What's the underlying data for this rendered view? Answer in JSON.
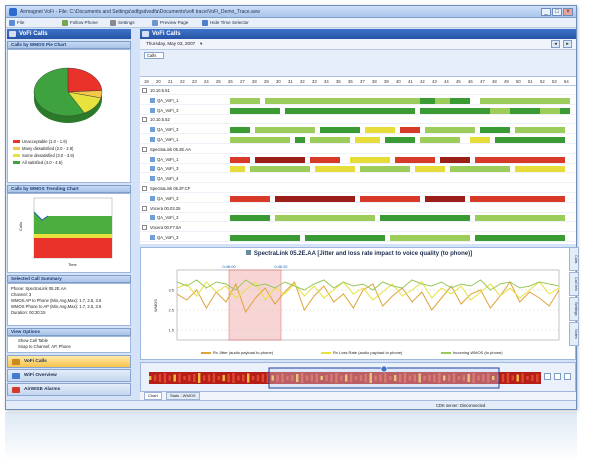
{
  "window": {
    "title": "Airmagnet VoFi - File: C:\\Documents and Settings\\sdfgsdvsdfa\\Documents\\vofi trace\\VoFi_Demo_Trace.avw",
    "minimize": "_",
    "maximize": "□",
    "close": "×"
  },
  "toolbar": {
    "file": "File",
    "follow_phone": "Follow Phone",
    "settings": "Settings",
    "preview_page": "Preview Page",
    "hide_time_selector": "Hide Time Selector"
  },
  "left_panel": {
    "header": "VoFi Calls",
    "pie_title": "Calls by WMOS Pie Chart",
    "pie_slices": [
      {
        "label": "Unacceptable (1.0 - 1.9)",
        "value": 24,
        "color": "#e8322a"
      },
      {
        "label": "Many dissatisfied (2.0 - 2.9)",
        "value": 5,
        "color": "#f4c84a"
      },
      {
        "label": "Some dissatisfied (3.0 - 3.9)",
        "value": 13,
        "color": "#e8e23f"
      },
      {
        "label": "All satisfied (4.0 - 4.5)",
        "value": 58,
        "color": "#3ea33e"
      }
    ],
    "trend_title": "Calls by WMOS Trending Chart",
    "trend_ylabel": "Calls",
    "trend_xlabel": "Time",
    "summary_title": "Selected Call Summary",
    "summary_lines": [
      "Phone: SpectraLink 05.2E.AA",
      "Channel: 3",
      "WMOS AP to Phone (Min,Avg,Max): 1.7, 2.5, 3.6",
      "WMOS Phone to AP (Min,Avg,Max): 1.7, 2.5, 3.6",
      "Duration: 00:30:15"
    ],
    "view_options_title": "View Options",
    "view_options": [
      "Show Call Table",
      "Snap to Channel: AP, Phone"
    ],
    "nav": [
      "VoFi Calls",
      "WiFi Overview",
      "AirWISE Alarms"
    ]
  },
  "right_panel": {
    "header": "VoFi Calls",
    "date": "Thursday, May 03, 2007",
    "view_label": "Calls",
    "hours": [
      "19",
      "20",
      "21",
      "22",
      "23",
      "24",
      "25",
      "26",
      "27",
      "28",
      "29",
      "30",
      "31",
      "32",
      "33",
      "34",
      "35",
      "36",
      "37",
      "38",
      "39",
      "40",
      "41",
      "42",
      "43",
      "44",
      "45",
      "46",
      "47",
      "48",
      "49",
      "50",
      "51",
      "52",
      "53",
      "54"
    ],
    "rows": [
      {
        "label": "10.10.5.51",
        "kind": "group"
      },
      {
        "label": "QA_VoFi_1",
        "kind": "call",
        "pattern": "green1"
      },
      {
        "label": "QA_VoFi_3",
        "kind": "call",
        "pattern": "green2"
      },
      {
        "label": "10.10.5.52",
        "kind": "group"
      },
      {
        "label": "QA_VoFi_3",
        "kind": "call",
        "pattern": "mixed1"
      },
      {
        "label": "QA_VoFi_1",
        "kind": "call",
        "pattern": "mixed2"
      },
      {
        "label": "SpectraLink 05.2E.AA",
        "kind": "group"
      },
      {
        "label": "QA_VoFi_1",
        "kind": "call",
        "pattern": "red1"
      },
      {
        "label": "QA_VoFi_3",
        "kind": "call",
        "pattern": "yellow1"
      },
      {
        "label": "QA_VoFi_4",
        "kind": "call",
        "pattern": "none"
      },
      {
        "label": "SpectraLink 05.2F.CF",
        "kind": "group"
      },
      {
        "label": "QA_VoFi_3",
        "kind": "call",
        "pattern": "red2"
      },
      {
        "label": "Vocera 00.03.25",
        "kind": "group"
      },
      {
        "label": "QA_VoFi_3",
        "kind": "call",
        "pattern": "green3"
      },
      {
        "label": "Vocera 00.F7.5A",
        "kind": "group"
      },
      {
        "label": "QA_VoFi_3",
        "kind": "call",
        "pattern": "green4"
      }
    ]
  },
  "chart_panel": {
    "title": "SpectraLink 05.2E.AA  [Jitter and loss rate impact to voice quality (to phone)]",
    "marker_left": "0:46:00",
    "marker_right": "0:46:32",
    "ylabel": "WMOS",
    "legend": [
      {
        "label": "Rx Jitter (audio payload to phone)",
        "color": "#e0a33a"
      },
      {
        "label": "Rx Loss Rate (audio payload to phone)",
        "color": "#e8e23f"
      },
      {
        "label": "Incoming WMOS (to phone)",
        "color": "#99c85a"
      }
    ],
    "side_tabs": [
      "Calls",
      "Call Info",
      "Settings",
      "Notes"
    ]
  },
  "chart_data": {
    "type": "line",
    "title": "SpectraLink 05.2E.AA  [Jitter and loss rate impact to voice quality (to phone)]",
    "ylabel": "WMOS",
    "ylim": [
      1,
      4.5
    ],
    "series": [
      {
        "name": "Rx Jitter (audio payload to phone)",
        "values": [
          3.3,
          3.0,
          3.5,
          2.6,
          3.4,
          2.9,
          3.8,
          2.4,
          3.1,
          3.6,
          2.8,
          3.4,
          3.9,
          2.5,
          3.2,
          3.7,
          2.9,
          3.3,
          2.6,
          3.5,
          3.8,
          2.7,
          3.2,
          3.6,
          2.9,
          3.4,
          2.5,
          3.1,
          3.7,
          2.8,
          3.3,
          3.5,
          2.6,
          3.2,
          3.9,
          2.9,
          3.4,
          3.1,
          2.7,
          3.5
        ]
      },
      {
        "name": "Rx Loss Rate (audio payload to phone)",
        "values": [
          3.6,
          3.8,
          3.2,
          3.9,
          3.4,
          3.7,
          3.1,
          3.5,
          3.9,
          3.0,
          3.6,
          3.3,
          3.8,
          3.2,
          3.7,
          3.1,
          3.5,
          3.9,
          3.3,
          3.6,
          3.0,
          3.4,
          3.8,
          3.2,
          3.5,
          3.9,
          3.1,
          3.6,
          3.3,
          3.7,
          3.0,
          3.4,
          3.8,
          3.2,
          3.6,
          3.1,
          3.5,
          3.9,
          3.3,
          3.6
        ]
      },
      {
        "name": "Incoming WMOS (to phone)",
        "values": [
          3.9,
          3.7,
          4.0,
          3.6,
          3.9,
          3.8,
          3.5,
          4.0,
          3.7,
          3.8,
          3.6,
          3.9,
          3.7,
          3.5,
          3.8,
          4.0,
          3.6,
          3.9,
          3.7,
          3.8,
          3.5,
          3.9,
          3.7,
          3.6,
          4.0,
          3.8,
          3.7,
          3.9,
          3.6,
          3.8,
          3.7,
          4.0,
          3.5,
          3.8,
          3.9,
          3.6,
          3.7,
          3.9,
          3.8,
          3.7
        ]
      }
    ]
  },
  "overview": {
    "tabs": [
      "Chart",
      "Stats - WMOS"
    ]
  },
  "status": {
    "text": "CDK server: Disconnected"
  },
  "colors": {
    "green": "#3a9a34",
    "lightgreen": "#9ccc5a",
    "yellow": "#e6dc3a",
    "red": "#d83a2a",
    "darkred": "#9c1e18"
  }
}
